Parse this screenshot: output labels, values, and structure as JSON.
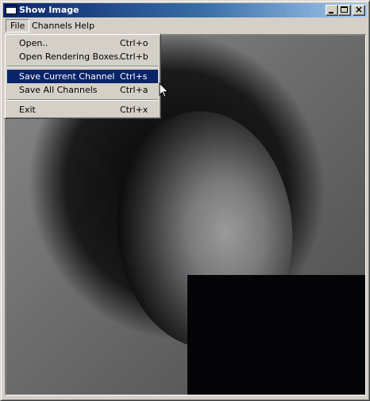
{
  "window": {
    "title": "Show Image",
    "controls": {
      "minimize_icon": "minimize-icon",
      "maximize_icon": "maximize-icon",
      "close_icon": "close-icon",
      "close_glyph": "×"
    }
  },
  "menubar": {
    "items": [
      {
        "label": "File"
      },
      {
        "label": "Channels"
      },
      {
        "label": "Help"
      }
    ]
  },
  "file_menu": {
    "items": [
      {
        "label": "Open..",
        "shortcut": "Ctrl+o"
      },
      {
        "label": "Open Rendering Boxes..",
        "shortcut": "Ctrl+b"
      },
      {
        "label": "Save Current Channel",
        "shortcut": "Ctrl+s",
        "highlighted": true
      },
      {
        "label": "Save All Channels",
        "shortcut": "Ctrl+a"
      },
      {
        "label": "Exit",
        "shortcut": "Ctrl+x"
      }
    ]
  },
  "colors": {
    "highlight": "#0a246a",
    "face": "#d4d0c8"
  }
}
